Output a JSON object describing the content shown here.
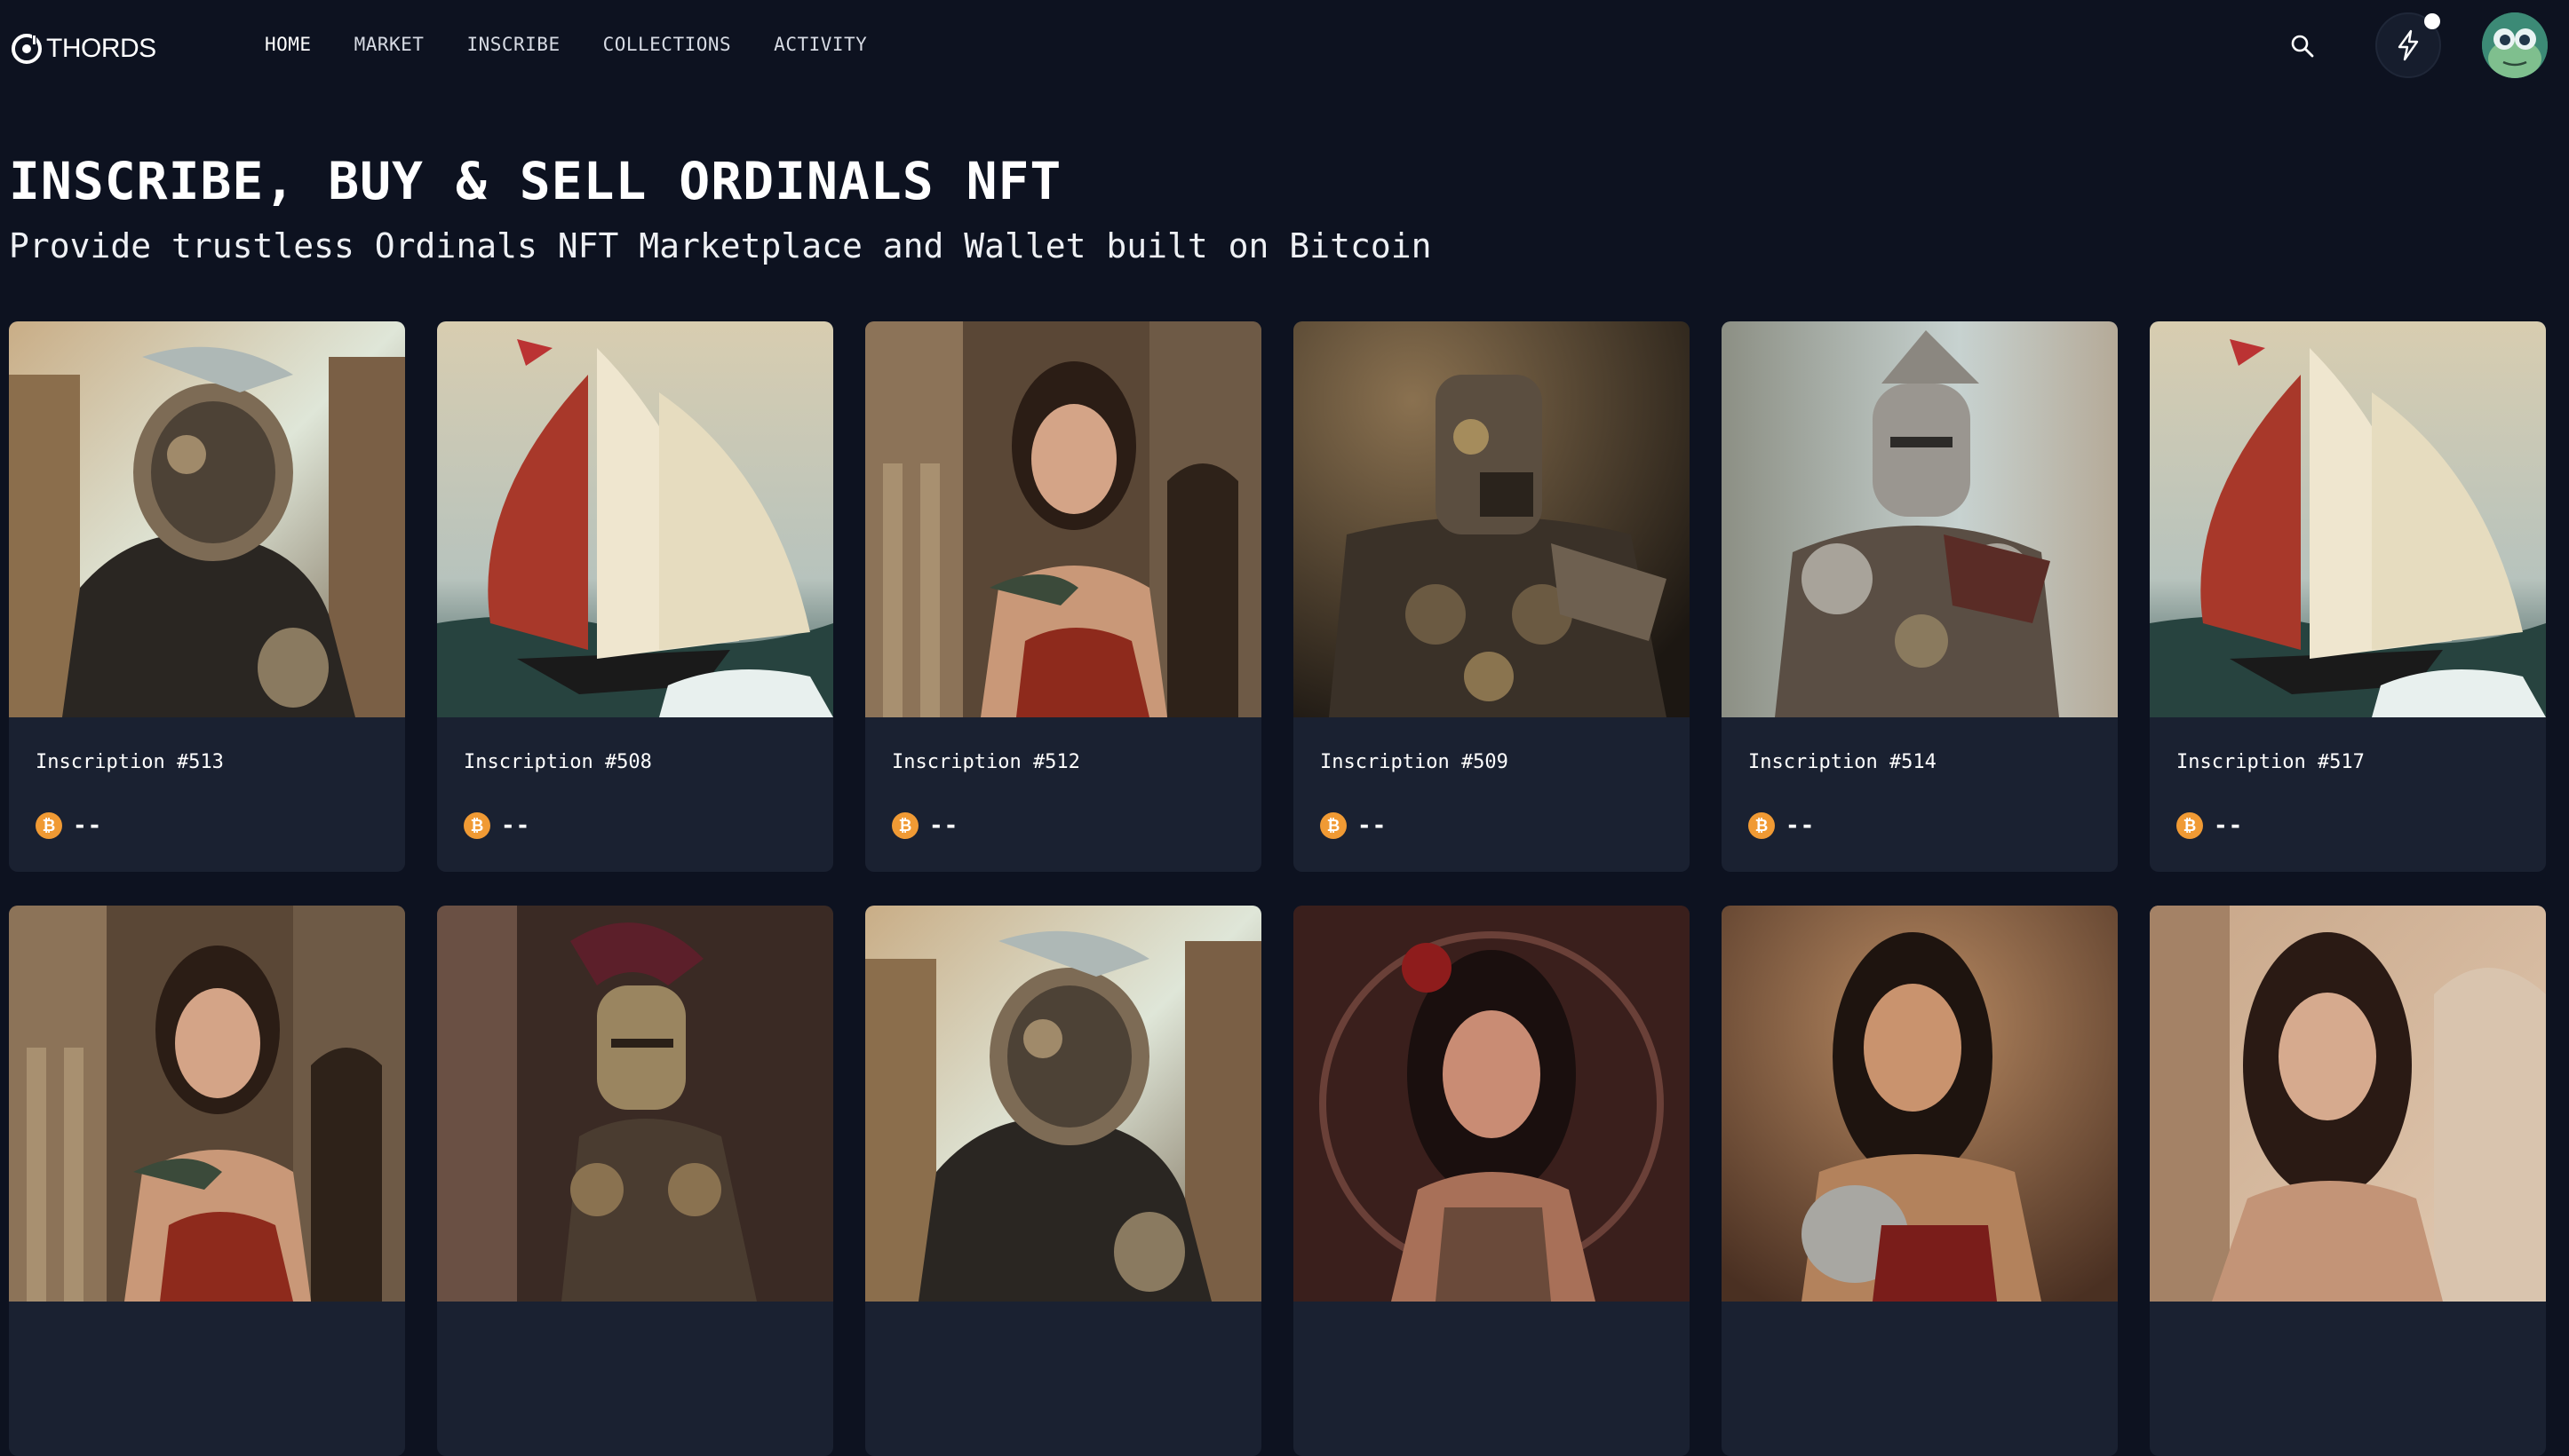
{
  "app": {
    "logo_text": "THORDS"
  },
  "nav": {
    "items": [
      {
        "label": "HOME",
        "active": true
      },
      {
        "label": "MARKET"
      },
      {
        "label": "INSCRIBE"
      },
      {
        "label": "COLLECTIONS"
      },
      {
        "label": "ACTIVITY"
      }
    ],
    "search_icon": "search-icon",
    "activity_icon": "lightning-bolt-icon",
    "has_notification": true
  },
  "hero": {
    "title": "INSCRIBE, BUY & SELL ORDINALS NFT",
    "subtitle": "Provide trustless Ordinals NFT Marketplace and Wallet built on Bitcoin"
  },
  "currency_icon": "bitcoin-icon",
  "accent_colors": {
    "bitcoin": "#f09a34",
    "background": "#0d1220",
    "card": "#1a2131"
  },
  "cards": [
    {
      "title": "Inscription #513",
      "price": "--",
      "image": "armored-knight-helmet"
    },
    {
      "title": "Inscription #508",
      "price": "--",
      "image": "sailing-ship"
    },
    {
      "title": "Inscription #512",
      "price": "--",
      "image": "roman-woman"
    },
    {
      "title": "Inscription #509",
      "price": "--",
      "image": "steampunk-robot-warrior"
    },
    {
      "title": "Inscription #514",
      "price": "--",
      "image": "crested-armored-knight"
    },
    {
      "title": "Inscription #517",
      "price": "--",
      "image": "sailing-ship"
    },
    {
      "title": "",
      "price": "",
      "image": "roman-woman"
    },
    {
      "title": "",
      "price": "",
      "image": "plumed-armored-knight"
    },
    {
      "title": "",
      "price": "",
      "image": "armored-knight-helmet"
    },
    {
      "title": "",
      "price": "",
      "image": "woman-with-rose"
    },
    {
      "title": "",
      "price": "",
      "image": "gladiator-woman"
    },
    {
      "title": "",
      "price": "",
      "image": "roman-woman-colosseum"
    }
  ]
}
